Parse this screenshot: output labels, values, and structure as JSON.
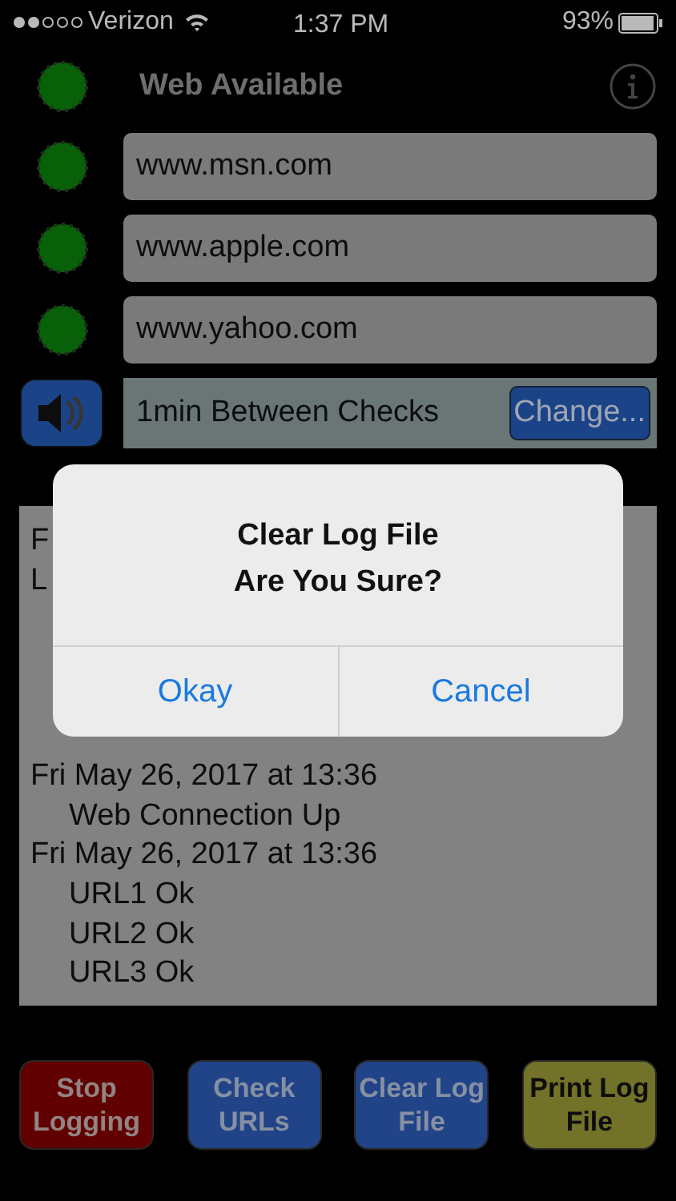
{
  "status_bar": {
    "carrier": "Verizon",
    "time": "1:37 PM",
    "battery": "93%"
  },
  "web": {
    "label": "Web Available",
    "up": true
  },
  "urls": [
    {
      "url": "www.msn.com",
      "up": true
    },
    {
      "url": "www.apple.com",
      "up": true
    },
    {
      "url": "www.yahoo.com",
      "up": true
    }
  ],
  "interval": {
    "text": "1min Between Checks",
    "button": "Change..."
  },
  "log": {
    "top_lines": [
      "F",
      "L"
    ],
    "lines": [
      {
        "text": "Fri May 26, 2017 at 13:36",
        "kind": "date"
      },
      {
        "text": "Web Connection Up",
        "kind": "detail"
      },
      {
        "text": "Fri May 26, 2017 at 13:36",
        "kind": "date"
      },
      {
        "text": "URL1 Ok",
        "kind": "detail"
      },
      {
        "text": "URL2 Ok",
        "kind": "detail"
      },
      {
        "text": "URL3 Ok",
        "kind": "detail"
      }
    ]
  },
  "buttons": [
    {
      "label": "Stop Logging",
      "kind": "red"
    },
    {
      "label": "Check URLs",
      "kind": "blue"
    },
    {
      "label": "Clear Log File",
      "kind": "blue"
    },
    {
      "label": "Print Log File",
      "kind": "yellow"
    }
  ],
  "alert": {
    "title": "Clear Log File",
    "message": "Are You Sure?",
    "buttons": [
      "Okay",
      "Cancel"
    ]
  }
}
